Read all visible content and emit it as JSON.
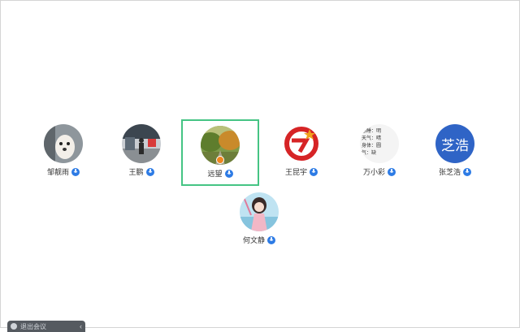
{
  "participants": [
    {
      "name": "邹靓雨",
      "avatar_icon": "dog-photo-icon"
    },
    {
      "name": "王鹏",
      "avatar_icon": "person-street-photo-icon"
    },
    {
      "name": "远望",
      "avatar_icon": "landscape-photo-icon",
      "selected": true,
      "host": true
    },
    {
      "name": "王昆宇",
      "avatar_icon": "red-logo-icon"
    },
    {
      "name": "万小彩",
      "avatar_icon": "text-note-avatar-icon",
      "avatar_lines": [
        {
          "k": "感睡：",
          "v": "明"
        },
        {
          "k": "天气：",
          "v": "晴"
        },
        {
          "k": "身体：",
          "v": "圆"
        },
        {
          "k": "气：",
          "v": "缺"
        }
      ]
    },
    {
      "name": "张芝浩",
      "avatar_icon": "initials-avatar-icon",
      "avatar_text": "芝浩",
      "avatar_color": "#2f64c6"
    },
    {
      "name": "何文静",
      "avatar_icon": "anime-girl-photo-icon"
    }
  ],
  "colors": {
    "selected_border": "#45c484",
    "mic": "#2d7be5",
    "host_badge": "#f0871f"
  },
  "bottom_bar": {
    "label": "退出会议",
    "toggle_icon": "chevron-left-icon"
  }
}
